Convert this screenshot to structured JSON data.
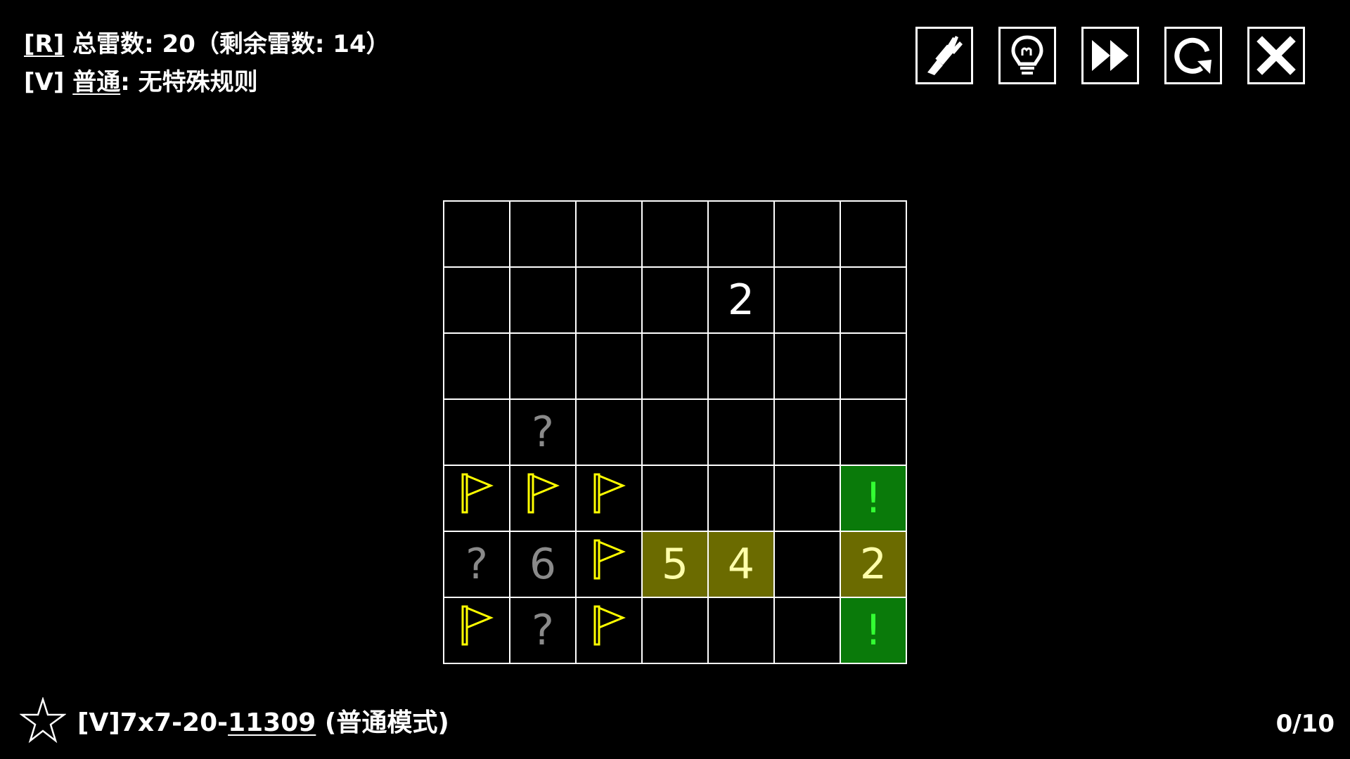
{
  "info": {
    "line1_key": "[R]",
    "line1_text": " 总雷数: 20（剩余雷数: 14）",
    "line2_key": "[V]",
    "line2_text_u": "普通",
    "line2_text": ": 无特殊规则"
  },
  "toolbar": [
    {
      "name": "brush-icon"
    },
    {
      "name": "lightbulb-icon"
    },
    {
      "name": "fast-forward-icon"
    },
    {
      "name": "restart-icon"
    },
    {
      "name": "close-icon"
    }
  ],
  "board": {
    "rows": 7,
    "cols": 7,
    "cells": [
      [
        "",
        "",
        "",
        "",
        "",
        "",
        ""
      ],
      [
        "",
        "",
        "",
        "",
        "2",
        "",
        ""
      ],
      [
        "",
        "",
        "",
        "",
        "",
        "",
        ""
      ],
      [
        "",
        "?",
        "",
        "",
        "",
        "",
        ""
      ],
      [
        "F",
        "F",
        "F",
        "",
        "",
        "",
        "!"
      ],
      [
        "?",
        "6",
        "F",
        "5",
        "4",
        "",
        "2"
      ],
      [
        "F",
        "?",
        "F",
        "",
        "",
        "",
        "!"
      ]
    ],
    "colors": {
      "flag": "#ffff00",
      "question": "#8a8a8a",
      "gray_number": "#8a8a8a",
      "olive_bg": "#6b6b00",
      "olive_text": "#ffffaa",
      "green_bg": "#0a7a0a",
      "green_mark": "#33ff33"
    },
    "highlight": {
      "5,3": "olive",
      "5,4": "olive",
      "5,6": "olive",
      "4,6": "green",
      "6,6": "green"
    }
  },
  "footer": {
    "puzzle_prefix": "[V]7x7-20-",
    "puzzle_id": "11309",
    "puzzle_mode": " (普通模式)",
    "progress": "0/10"
  }
}
